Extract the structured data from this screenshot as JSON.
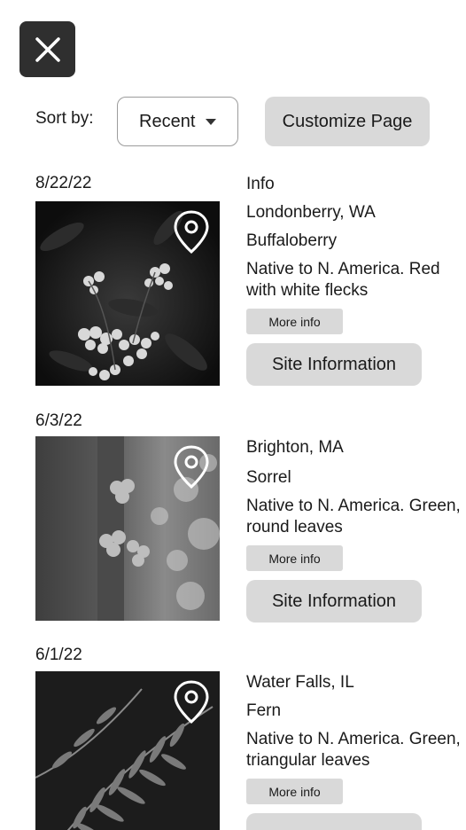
{
  "header": {
    "close_icon": "close-icon",
    "sort_label": "Sort by:",
    "sort_value": "Recent",
    "customize_label": "Customize Page"
  },
  "entries": [
    {
      "date": "8/22/22",
      "heading": "Info",
      "location": "Londonberry, WA",
      "name": "Buffaloberry",
      "description": "Native to N. America. Red with white flecks",
      "more_label": "More info",
      "site_label": "Site Information",
      "photo_subject": "buffaloberry-photo"
    },
    {
      "date": "6/3/22",
      "location": "Brighton, MA",
      "name": "Sorrel",
      "description": "Native to N. America. Green, round leaves",
      "more_label": "More info",
      "site_label": "Site Information",
      "photo_subject": "sorrel-photo"
    },
    {
      "date": "6/1/22",
      "location": "Water Falls, IL",
      "name": "Fern",
      "description": "Native to N. America. Green, triangular leaves",
      "more_label": "More info",
      "photo_subject": "fern-photo"
    }
  ]
}
